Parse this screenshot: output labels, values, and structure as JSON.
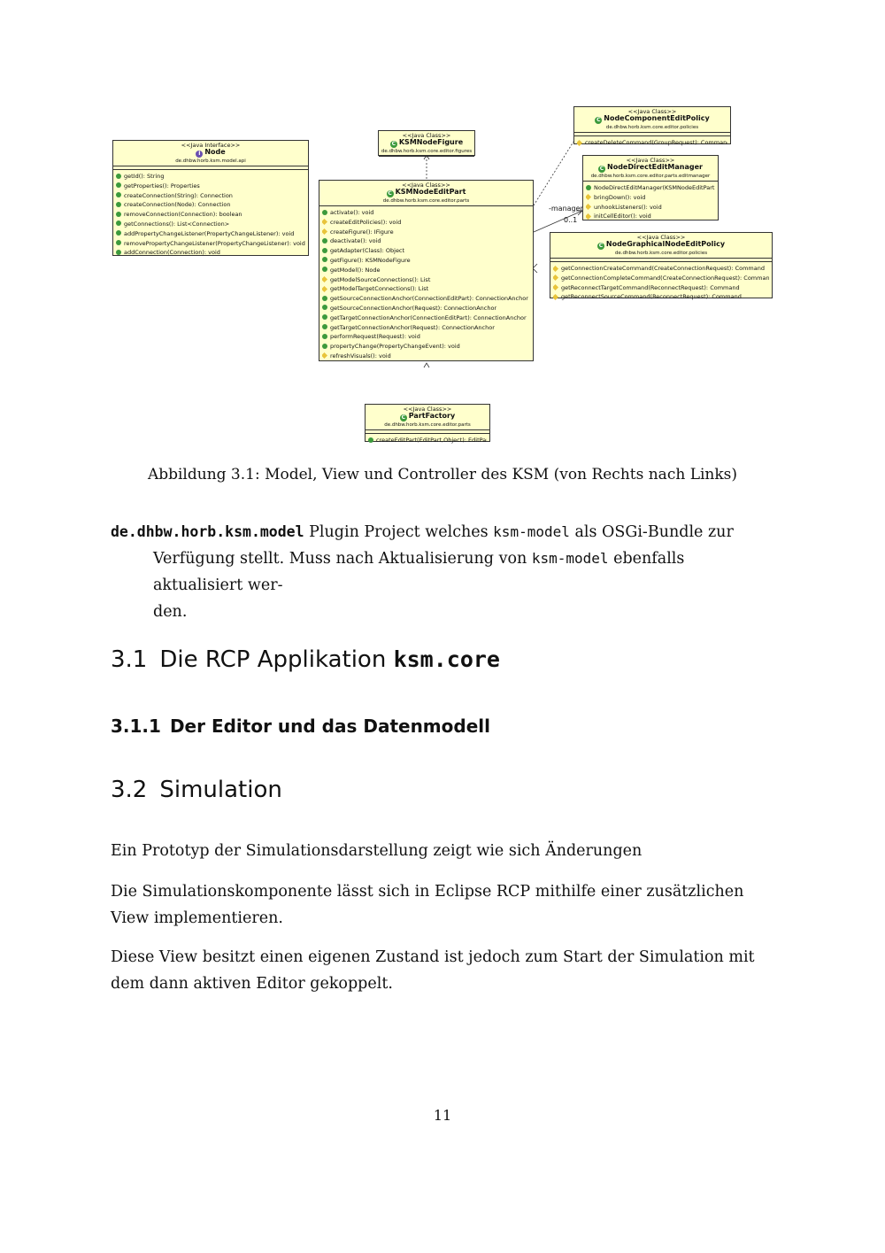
{
  "diagram": {
    "node": {
      "stereotype": "<<Java Interface>>",
      "name": "Node",
      "package": "de.dhbw.horb.ksm.model.api",
      "methods": [
        "getId(): String",
        "getProperties(): Properties",
        "createConnection(String): Connection",
        "createConnection(Node): Connection",
        "removeConnection(Connection): boolean",
        "getConnections(): List<Connection>",
        "addPropertyChangeListener(PropertyChangeListener): void",
        "removePropertyChangeListener(PropertyChangeListener): void",
        "addConnection(Connection): void"
      ]
    },
    "ksm_node_figure": {
      "stereotype": "<<Java Class>>",
      "name": "KSMNodeFigure",
      "package": "de.dhbw.horb.ksm.core.editor.figures"
    },
    "ksm_node_edit_part": {
      "stereotype": "<<Java Class>>",
      "name": "KSMNodeEditPart",
      "package": "de.dhbw.horb.ksm.core.editor.parts",
      "methods": [
        "activate(): void",
        "createEditPolicies(): void",
        "createFigure(): IFigure",
        "deactivate(): void",
        "getAdapter(Class): Object",
        "getFigure(): KSMNodeFigure",
        "getModel(): Node",
        "getModelSourceConnections(): List",
        "getModelTargetConnections(): List",
        "getSourceConnectionAnchor(ConnectionEditPart): ConnectionAnchor",
        "getSourceConnectionAnchor(Request): ConnectionAnchor",
        "getTargetConnectionAnchor(ConnectionEditPart): ConnectionAnchor",
        "getTargetConnectionAnchor(Request): ConnectionAnchor",
        "performRequest(Request): void",
        "propertyChange(PropertyChangeEvent): void",
        "refreshVisuals(): void"
      ],
      "method_visibility": [
        "public",
        "protected",
        "protected",
        "public",
        "public",
        "public",
        "public",
        "protected",
        "protected",
        "public",
        "public",
        "public",
        "public",
        "public",
        "public",
        "protected"
      ]
    },
    "node_component_edit_policy": {
      "stereotype": "<<Java Class>>",
      "name": "NodeComponentEditPolicy",
      "package": "de.dhbw.horb.ksm.core.editor.policies",
      "methods": [
        "createDeleteCommand(GroupRequest): Command"
      ],
      "method_visibility": [
        "protected"
      ]
    },
    "node_direct_edit_manager": {
      "stereotype": "<<Java Class>>",
      "name": "NodeDirectEditManager",
      "package": "de.dhbw.horb.ksm.core.editor.parts.editmanager",
      "methods": [
        "NodeDirectEditManager(KSMNodeEditPart)",
        "bringDown(): void",
        "unhookListeners(): void",
        "initCellEditor(): void"
      ],
      "method_visibility": [
        "constructor",
        "protected",
        "protected",
        "protected"
      ]
    },
    "node_graphical_node_edit_policy": {
      "stereotype": "<<Java Class>>",
      "name": "NodeGraphicalNodeEditPolicy",
      "package": "de.dhbw.horb.ksm.core.editor.policies",
      "methods": [
        "getConnectionCreateCommand(CreateConnectionRequest): Command",
        "getConnectionCompleteCommand(CreateConnectionRequest): Command",
        "getReconnectTargetCommand(ReconnectRequest): Command",
        "getReconnectSourceCommand(ReconnectRequest): Command"
      ],
      "method_visibility": [
        "protected",
        "protected",
        "protected",
        "protected"
      ]
    },
    "part_factory": {
      "stereotype": "<<Java Class>>",
      "name": "PartFactory",
      "package": "de.dhbw.horb.ksm.core.editor.parts",
      "methods": [
        "createEditPart(EditPart,Object): EditPart"
      ],
      "method_visibility": [
        "public"
      ]
    },
    "edge_label_manager": "-manager",
    "edge_label_multiplicity": "0..1"
  },
  "caption": "Abbildung 3.1: Model, View und Controller des KSM (von Rechts nach Links)",
  "definition": {
    "term": "de.dhbw.horb.ksm.model",
    "line1_a": "Plugin Project welches ",
    "line1_code": "ksm-model",
    "line1_b": " als OSGi-Bundle zur",
    "line2_a": "Verfügung stellt. Muss nach Aktualisierung von ",
    "line2_code": "ksm-model",
    "line2_b": " ebenfalls aktualisiert wer-",
    "line3": "den."
  },
  "section_3_1": {
    "number": "3.1",
    "title": "Die RCP Applikation ",
    "code": "ksm.core"
  },
  "section_3_1_1": {
    "number": "3.1.1",
    "title": "Der Editor und das Datenmodell"
  },
  "section_3_2": {
    "number": "3.2",
    "title": "Simulation"
  },
  "paragraphs": [
    "Ein Prototyp der Simulationsdarstellung zeigt wie sich Änderungen",
    "Die Simulationskomponente lässt sich in Eclipse RCP mithilfe einer zusätzlichen View implementieren.",
    "Diese View besitzt einen eigenen Zustand ist jedoch zum Start der Simulation mit dem dann aktiven Editor gekoppelt."
  ],
  "page_number": "11"
}
